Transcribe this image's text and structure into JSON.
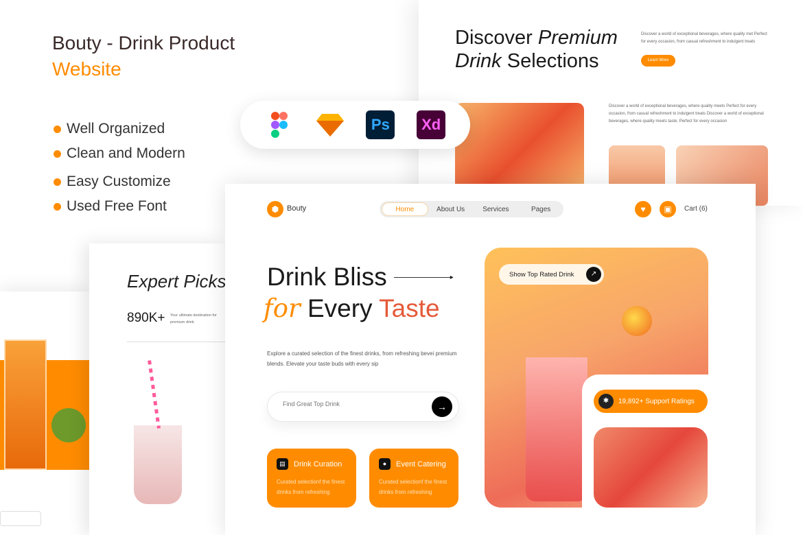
{
  "promo": {
    "title_line1": "Bouty - Drink Product",
    "title_line2": "Website",
    "features": [
      "Well Organized",
      "Clean and Modern",
      "Easy Customize",
      "Used Free Font"
    ]
  },
  "tools": [
    {
      "icon": "figma-icon",
      "label": ""
    },
    {
      "icon": "sketch-icon",
      "label": ""
    },
    {
      "icon": "photoshop-icon",
      "label": "Ps"
    },
    {
      "icon": "xd-icon",
      "label": "Xd"
    }
  ],
  "top_right": {
    "heading_a": "Discover ",
    "heading_b": "Premium",
    "heading_c": "Drink",
    "heading_d": " Selections",
    "text": "Discover a world of exceptional beverages, where quality met Perfect for every occasion, from casual refreshment to indulgent treats",
    "button": "Learn More",
    "text2": "Discover a world of exceptional beverages, where quality meets Perfect for every occasion, from casual refreshment to indulgent treats Discover a world of exceptional beverages, where quality meets taste. Perfect for every occasion"
  },
  "expert": {
    "title": "Expert Picks",
    "stat": "890K+",
    "stat_text": "Your ultimate destination for premium drink"
  },
  "main": {
    "brand": "Bouty",
    "nav": [
      "Home",
      "About Us",
      "Services",
      "Pages"
    ],
    "cart": "Cart (6)",
    "hero_line1": "Drink Bliss",
    "hero_for": "for",
    "hero_every": "Every",
    "hero_taste": "Taste",
    "description": "Explore a curated selection of the finest drinks, from refreshing bevei premium blends. Elevate your taste buds with every sip",
    "search_placeholder": "Find Great Top Drink",
    "cards": [
      {
        "title": "Drink Curation",
        "text": "Curated selectionf the finest drinks from refreshing"
      },
      {
        "title": "Event Catering",
        "text": "Curated selectionf the finest drinks from refreshing"
      }
    ],
    "top_rated": "Show Top Rated Drink",
    "ratings": "19,892+ Support Ratings"
  },
  "colors": {
    "accent": "#ff8c00"
  }
}
